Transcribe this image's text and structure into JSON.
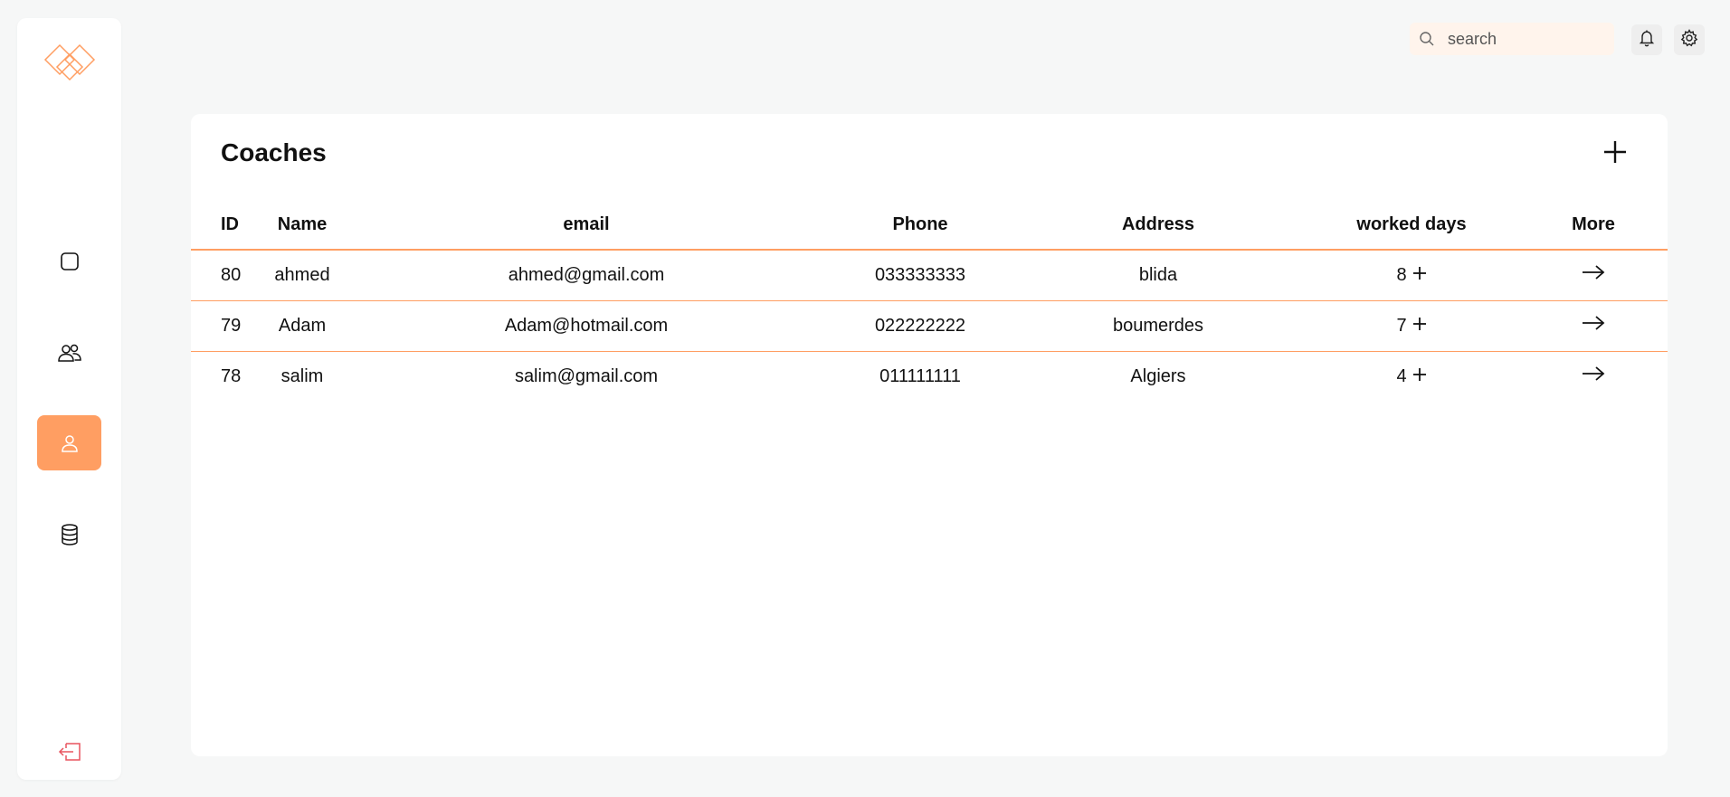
{
  "colors": {
    "accent": "#ff9e62",
    "logout": "#e8535e",
    "background": "#f6f7f7"
  },
  "sidebar": {
    "logo": "diamond-logo",
    "items": [
      {
        "icon": "square-icon",
        "active": false
      },
      {
        "icon": "users-icon",
        "active": false
      },
      {
        "icon": "user-icon",
        "active": true
      },
      {
        "icon": "database-icon",
        "active": false
      }
    ],
    "logout_icon": "logout-icon"
  },
  "topbar": {
    "search": {
      "placeholder": "search",
      "value": ""
    },
    "notification_icon": "bell-icon",
    "settings_icon": "gear-icon"
  },
  "main": {
    "title": "Coaches",
    "add_icon": "plus-icon",
    "table": {
      "columns": [
        "ID",
        "Name",
        "email",
        "Phone",
        "Address",
        "worked days",
        "More"
      ],
      "rows": [
        {
          "id": "80",
          "name": "ahmed",
          "email": "ahmed@gmail.com",
          "phone": "033333333",
          "address": "blida",
          "worked_days": "8"
        },
        {
          "id": "79",
          "name": "Adam",
          "email": "Adam@hotmail.com",
          "phone": "022222222",
          "address": "boumerdes",
          "worked_days": "7"
        },
        {
          "id": "78",
          "name": "salim",
          "email": "salim@gmail.com",
          "phone": "011111111",
          "address": "Algiers",
          "worked_days": "4"
        }
      ]
    }
  }
}
